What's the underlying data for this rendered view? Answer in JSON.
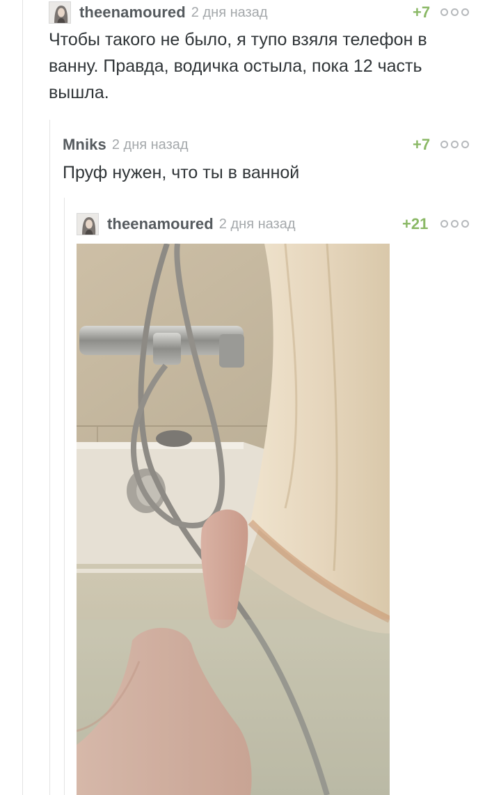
{
  "comments": [
    {
      "author": "theenamoured",
      "time": "2 дня назад",
      "rating": "+7",
      "text": "Чтобы такого не было, я тупо взяля телефон в ванну. Правда, водичка остыла, пока 12 часть вышла.",
      "has_avatar": true
    },
    {
      "author": "Mniks",
      "time": "2 дня назад",
      "rating": "+7",
      "text": "Пруф нужен, что ты в ванной",
      "has_avatar": false
    },
    {
      "author": "theenamoured",
      "time": "2 дня назад",
      "rating": "+21",
      "text": "",
      "has_avatar": true,
      "attachment": "photo"
    }
  ],
  "icons": {
    "more": "more-options-icon"
  },
  "colors": {
    "rating_positive": "#8ab865",
    "author": "#555a5e",
    "time": "#a4a8ab"
  }
}
